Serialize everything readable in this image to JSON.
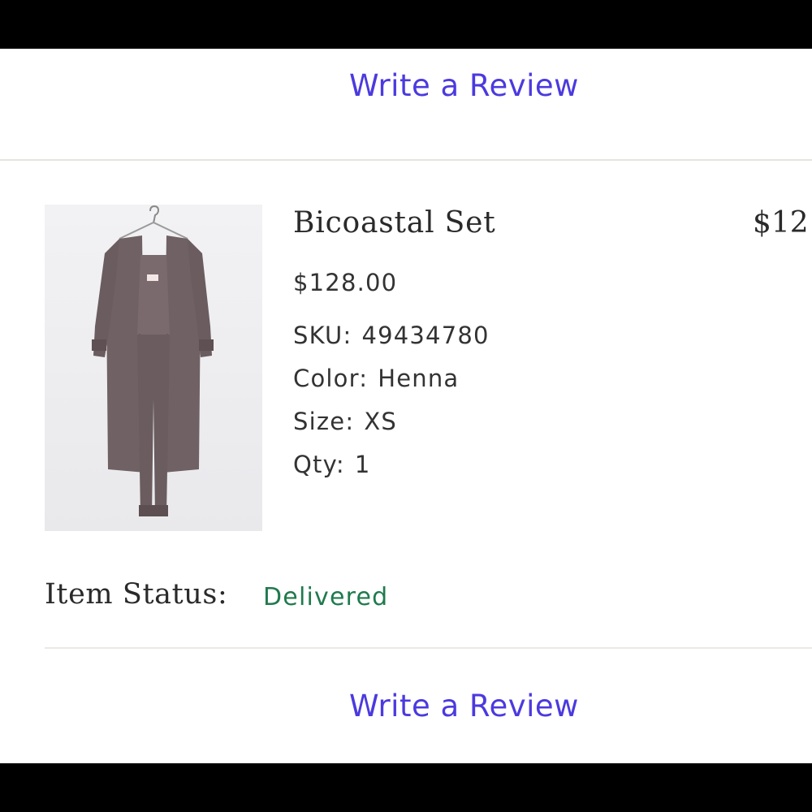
{
  "order_item": {
    "review_link_top": "Write a Review",
    "product": {
      "name": "Bicoastal Set",
      "line_total": "$12",
      "price": "$128.00",
      "sku_label": "SKU:",
      "sku_value": "49434780",
      "color_label": "Color:",
      "color_value": "Henna",
      "size_label": "Size:",
      "size_value": "XS",
      "qty_label": "Qty:",
      "qty_value": "1"
    },
    "status_label": "Item Status:",
    "status_value": "Delivered",
    "review_link_bottom": "Write a Review"
  },
  "colors": {
    "link": "#4b3adf",
    "status_delivered": "#1f7a4d",
    "product_color": "#6e5f62"
  },
  "icons": {
    "product_image": "product-photo-bicoastal-set"
  }
}
